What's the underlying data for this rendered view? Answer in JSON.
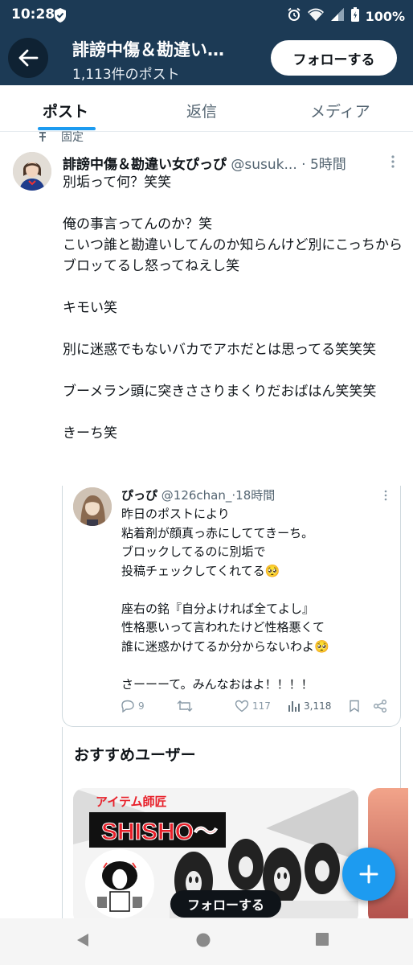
{
  "status_bar": {
    "time": "10:28",
    "battery": "100%"
  },
  "header": {
    "title": "誹謗中傷＆勘違い…",
    "post_count": "1,113件のポスト",
    "follow_label": "フォローする"
  },
  "tabs": [
    {
      "label": "ポスト",
      "active": true
    },
    {
      "label": "返信",
      "active": false
    },
    {
      "label": "メディア",
      "active": false
    }
  ],
  "pinned_label": "固定",
  "tweet": {
    "author_name": "誹謗中傷＆勘違い女ぴっぴ",
    "author_handle": "@susuk...",
    "separator": "·",
    "time": "5時間",
    "text": "別垢って何？笑笑\n\n俺の事言ってんのか？笑\nこいつ誰と勘違いしてんのか知らんけど別にこっちからブロッてるし怒ってねえし笑\n\nキモい笑\n\n別に迷惑でもないバカでアホだとは思ってる笑笑笑\n\nブーメラン頭に突きささりまくりだおばはん笑笑笑\n\nきーち笑"
  },
  "quote": {
    "author_name": "ぴっぴ",
    "author_handle": "@126chan_",
    "separator": "·",
    "time": "18時間",
    "text": "昨日のポストにより\n粘着剤が顔真っ赤にしててきーち。\nブロックしてるのに別垢で\n投稿チェックしてくれてる🥺\n\n座右の銘『自分よければ全てよし』\n性格悪いって言われたけど性格悪くて\n誰に迷惑かけてるか分からないわよ🥺\n\nさーーーて。みんなおはよ！！！！",
    "replies": "9",
    "likes": "117",
    "views": "3,118"
  },
  "recommended": {
    "title": "おすすめユーザー",
    "card_banner_text": "SHISHO〜",
    "card_banner_kana": "アイテム師匠",
    "follow_label": "フォローする"
  },
  "colors": {
    "header_bg": "#1c3a55",
    "accent": "#1d9bf0",
    "text_primary": "#0f1419",
    "text_secondary": "#536471"
  }
}
